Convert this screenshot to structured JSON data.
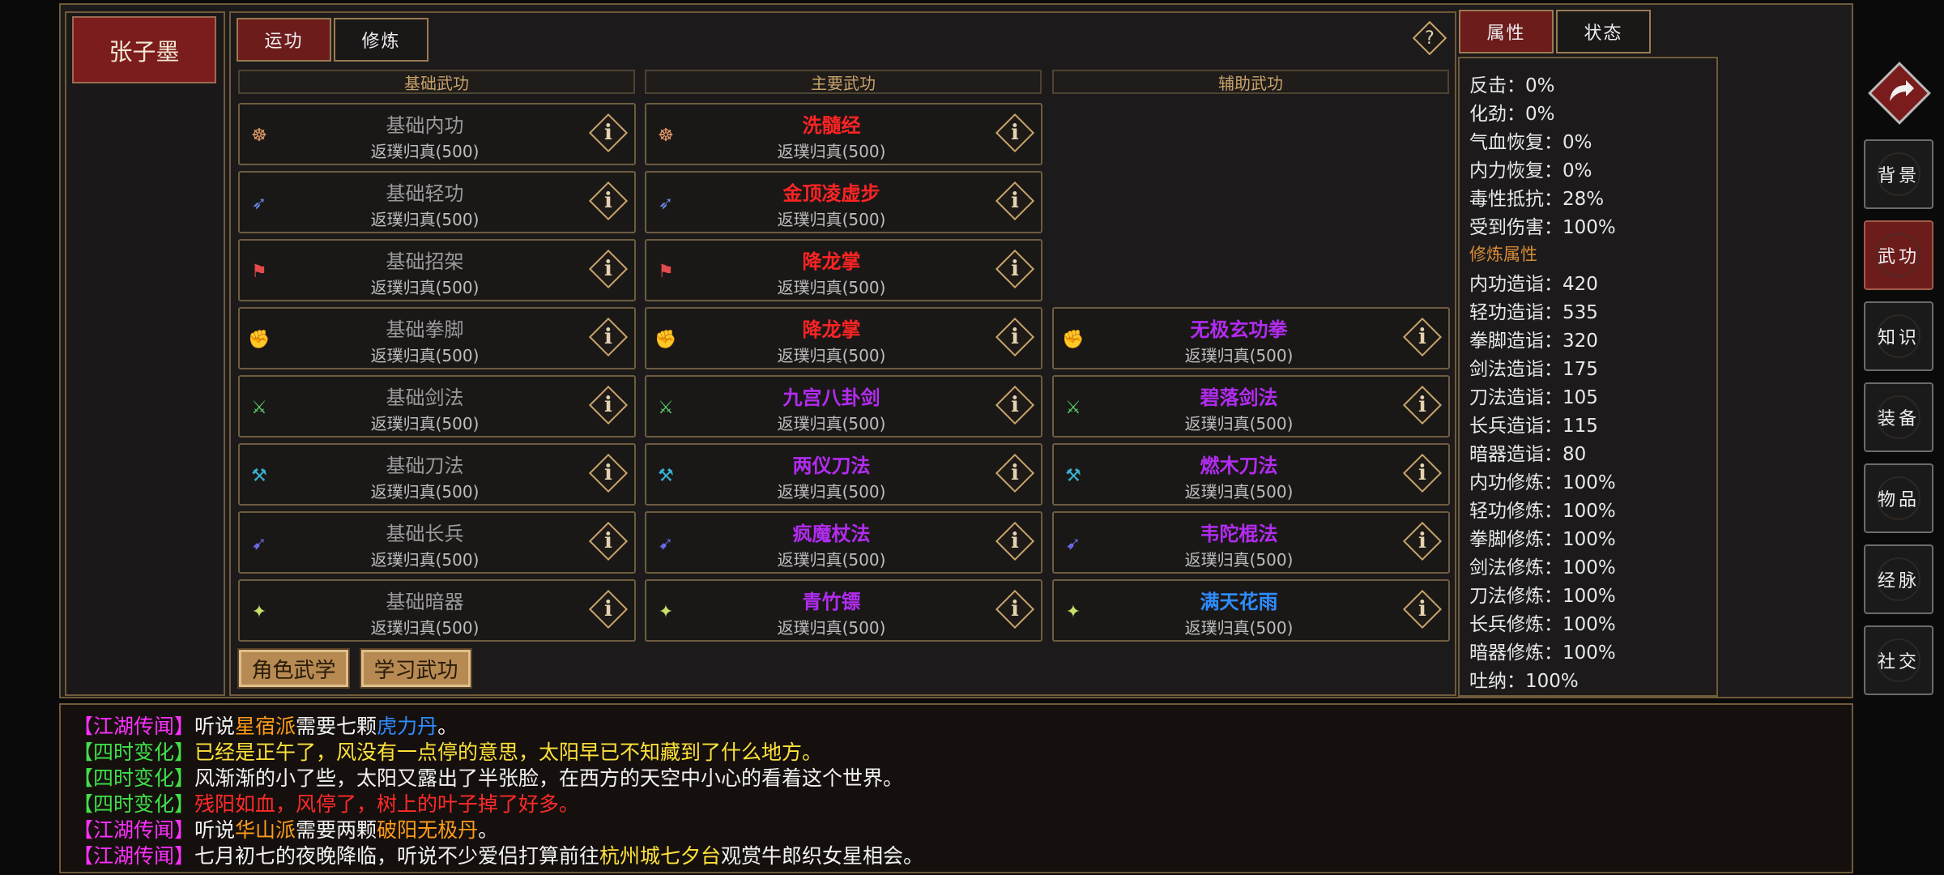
{
  "character": {
    "name": "张子墨"
  },
  "tabs_left": [
    {
      "label": "运功",
      "active": true
    },
    {
      "label": "修炼",
      "active": false
    }
  ],
  "tabs_right": [
    {
      "label": "属性",
      "active": true
    },
    {
      "label": "状态",
      "active": false
    }
  ],
  "help_label": "?",
  "columns": [
    "基础武功",
    "主要武功",
    "辅助武功"
  ],
  "skill_level": "返璞归真(500)",
  "info_glyph": "i",
  "colors": {
    "gray": "#9a9a9a",
    "red": "#ff2424",
    "purple": "#b22cf0",
    "blue": "#2f8cff",
    "green": "#40e04a",
    "magenta": "#ff30ff",
    "orange": "#ff9c1a",
    "yellow": "#ffe23a",
    "brightred": "#ff2a2a",
    "accent": "#6d1c1c"
  },
  "skills": {
    "basic": [
      {
        "name": "基础内功",
        "color": "#9a9a9a",
        "icon": "meditate-icon"
      },
      {
        "name": "基础轻功",
        "color": "#9a9a9a",
        "icon": "leap-icon"
      },
      {
        "name": "基础招架",
        "color": "#9a9a9a",
        "icon": "parry-icon"
      },
      {
        "name": "基础拳脚",
        "color": "#9a9a9a",
        "icon": "fist-icon"
      },
      {
        "name": "基础剑法",
        "color": "#9a9a9a",
        "icon": "sword-icon"
      },
      {
        "name": "基础刀法",
        "color": "#9a9a9a",
        "icon": "blade-icon"
      },
      {
        "name": "基础长兵",
        "color": "#9a9a9a",
        "icon": "spear-icon"
      },
      {
        "name": "基础暗器",
        "color": "#9a9a9a",
        "icon": "dart-icon"
      }
    ],
    "main": [
      {
        "name": "洗髓经",
        "color": "#ff2424",
        "icon": "meditate-icon"
      },
      {
        "name": "金顶凌虚步",
        "color": "#ff2424",
        "icon": "leap-icon"
      },
      {
        "name": "降龙掌",
        "color": "#ff2424",
        "icon": "parry-icon"
      },
      {
        "name": "降龙掌",
        "color": "#ff2424",
        "icon": "fist-icon"
      },
      {
        "name": "九宫八卦剑",
        "color": "#b22cf0",
        "icon": "sword-icon"
      },
      {
        "name": "两仪刀法",
        "color": "#b22cf0",
        "icon": "blade-icon"
      },
      {
        "name": "疯魔杖法",
        "color": "#b22cf0",
        "icon": "spear-icon"
      },
      {
        "name": "青竹镖",
        "color": "#b22cf0",
        "icon": "dart-icon"
      }
    ],
    "aux": [
      {
        "name": "无极玄功拳",
        "color": "#b22cf0",
        "icon": "fist-icon"
      },
      {
        "name": "碧落剑法",
        "color": "#b22cf0",
        "icon": "sword-icon"
      },
      {
        "name": "燃木刀法",
        "color": "#b22cf0",
        "icon": "blade-icon"
      },
      {
        "name": "韦陀棍法",
        "color": "#b22cf0",
        "icon": "spear-icon"
      },
      {
        "name": "满天花雨",
        "color": "#2f8cff",
        "icon": "dart-icon"
      }
    ]
  },
  "buttons": {
    "character_martial": "角色武学",
    "learn_martial": "学习武功"
  },
  "stats": [
    {
      "label": "反击：",
      "value": "0%"
    },
    {
      "label": "化劲：",
      "value": "0%"
    },
    {
      "label": "气血恢复：",
      "value": "0%"
    },
    {
      "label": "内力恢复：",
      "value": "0%"
    },
    {
      "label": "毒性抵抗：",
      "value": "28%"
    },
    {
      "label": "受到伤害：",
      "value": "100%"
    }
  ],
  "cultivation_section": "修炼属性",
  "cultivation_stats": [
    {
      "label": "内功造诣：",
      "value": "420"
    },
    {
      "label": "轻功造诣：",
      "value": "535"
    },
    {
      "label": "拳脚造诣：",
      "value": "320"
    },
    {
      "label": "剑法造诣：",
      "value": "175"
    },
    {
      "label": "刀法造诣：",
      "value": "105"
    },
    {
      "label": "长兵造诣：",
      "value": "115"
    },
    {
      "label": "暗器造诣：",
      "value": "80"
    },
    {
      "label": "内功修炼：",
      "value": "100%"
    },
    {
      "label": "轻功修炼：",
      "value": "100%"
    },
    {
      "label": "拳脚修炼：",
      "value": "100%"
    },
    {
      "label": "剑法修炼：",
      "value": "100%"
    },
    {
      "label": "刀法修炼：",
      "value": "100%"
    },
    {
      "label": "长兵修炼：",
      "value": "100%"
    },
    {
      "label": "暗器修炼：",
      "value": "100%"
    },
    {
      "label": "吐纳：",
      "value": "100%"
    }
  ],
  "side_menu": [
    {
      "label": "背景",
      "active": false
    },
    {
      "label": "武功",
      "active": true
    },
    {
      "label": "知识",
      "active": false
    },
    {
      "label": "装备",
      "active": false
    },
    {
      "label": "物品",
      "active": false
    },
    {
      "label": "经脉",
      "active": false
    },
    {
      "label": "社交",
      "active": false
    }
  ],
  "log": [
    [
      {
        "t": "【江湖传闻】",
        "c": "#ff30ff"
      },
      {
        "t": "听说",
        "c": "#f2f2f2"
      },
      {
        "t": "星宿派",
        "c": "#ff9c1a"
      },
      {
        "t": "需要七颗",
        "c": "#f2f2f2"
      },
      {
        "t": "虎力丹",
        "c": "#2f8cff"
      },
      {
        "t": "。",
        "c": "#f2f2f2"
      }
    ],
    [
      {
        "t": "【四时变化】",
        "c": "#40e04a"
      },
      {
        "t": "已经是正午了，风没有一点停的意思，太阳早已不知藏到了什么地方。",
        "c": "#ffe23a"
      }
    ],
    [
      {
        "t": "【四时变化】",
        "c": "#40e04a"
      },
      {
        "t": "风渐渐的小了些，太阳又露出了半张脸，在西方的天空中小心的看着这个世界。",
        "c": "#f2f2f2"
      }
    ],
    [
      {
        "t": "【四时变化】",
        "c": "#40e04a"
      },
      {
        "t": "残阳如血，风停了，树上的叶子掉了好多。",
        "c": "#ff2a2a"
      }
    ],
    [
      {
        "t": "【江湖传闻】",
        "c": "#ff30ff"
      },
      {
        "t": "听说",
        "c": "#f2f2f2"
      },
      {
        "t": "华山派",
        "c": "#ff9c1a"
      },
      {
        "t": "需要两颗",
        "c": "#f2f2f2"
      },
      {
        "t": "破阳无极丹",
        "c": "#ff9c1a"
      },
      {
        "t": "。",
        "c": "#f2f2f2"
      }
    ],
    [
      {
        "t": "【江湖传闻】",
        "c": "#ff30ff"
      },
      {
        "t": "七月初七的夜晚降临，听说不少爱侣打算前往",
        "c": "#f2f2f2"
      },
      {
        "t": "杭州城七夕台",
        "c": "#ffe23a"
      },
      {
        "t": "观赏牛郎织女星相会。",
        "c": "#f2f2f2"
      }
    ]
  ]
}
